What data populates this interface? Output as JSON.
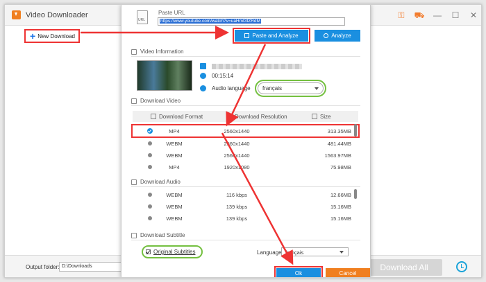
{
  "app": {
    "title": "Video Downloader",
    "new_download": "New Download"
  },
  "bottom": {
    "output_label": "Output folder:",
    "output_path": "D:\\Downloads",
    "download_all": "Download All"
  },
  "dialog": {
    "paste_url_label": "Paste URL",
    "url_value": "https://www.youtube.com/watch?v=uaHmt3fZRdM",
    "paste_analyze": "Paste and Analyze",
    "analyze": "Analyze",
    "video_info": "Video Information",
    "duration": "00:15:14",
    "audio_language_label": "Audio language",
    "audio_language_value": "français",
    "download_video": "Download Video",
    "col_format": "Download Format",
    "col_resolution": "Download Resolution",
    "col_size": "Size",
    "video_rows": [
      {
        "format": "MP4",
        "resolution": "2560x1440",
        "size": "313.35MB"
      },
      {
        "format": "WEBM",
        "resolution": "2560x1440",
        "size": "481.44MB"
      },
      {
        "format": "WEBM",
        "resolution": "2560x1440",
        "size": "1563.97MB"
      },
      {
        "format": "MP4",
        "resolution": "1920x1080",
        "size": "75.98MB"
      }
    ],
    "download_audio": "Download Audio",
    "audio_rows": [
      {
        "format": "WEBM",
        "bitrate": "116 kbps",
        "size": "12.66MB"
      },
      {
        "format": "WEBM",
        "bitrate": "139 kbps",
        "size": "15.16MB"
      },
      {
        "format": "WEBM",
        "bitrate": "139 kbps",
        "size": "15.16MB"
      }
    ],
    "download_subtitle": "Download Subtitle",
    "original_subtitles": "Original Subtitles",
    "language_label": "Language",
    "language_value": "français",
    "ok": "Ok",
    "cancel": "Cancel"
  },
  "icons": {
    "url": "URL"
  }
}
